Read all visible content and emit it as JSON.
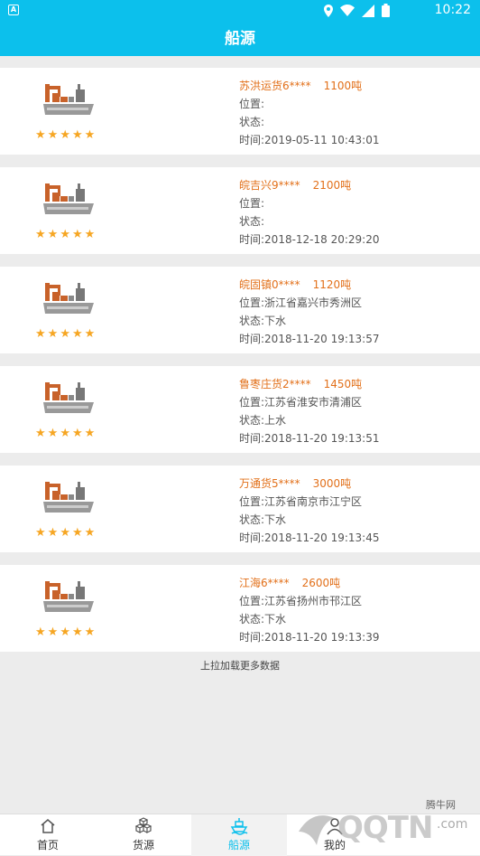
{
  "status_bar": {
    "app_icon_letter": "A",
    "time": "10:22"
  },
  "header": {
    "title": "船源"
  },
  "ships": [
    {
      "name": "苏洪运货6****",
      "tons": "1100吨",
      "location": "位置:",
      "status": "状态:",
      "time": "时间:2019-05-11 10:43:01"
    },
    {
      "name": "皖吉兴9****",
      "tons": "2100吨",
      "location": "位置:",
      "status": "状态:",
      "time": "时间:2018-12-18 20:29:20"
    },
    {
      "name": "皖固镇0****",
      "tons": "1120吨",
      "location": "位置:浙江省嘉兴市秀洲区",
      "status": "状态:下水",
      "time": "时间:2018-11-20 19:13:57"
    },
    {
      "name": "鲁枣庄货2****",
      "tons": "1450吨",
      "location": "位置:江苏省淮安市清浦区",
      "status": "状态:上水",
      "time": "时间:2018-11-20 19:13:51"
    },
    {
      "name": "万通货5****",
      "tons": "3000吨",
      "location": "位置:江苏省南京市江宁区",
      "status": "状态:下水",
      "time": "时间:2018-11-20 19:13:45"
    },
    {
      "name": "江海6****",
      "tons": "2600吨",
      "location": "位置:江苏省扬州市邗江区",
      "status": "状态:下水",
      "time": "时间:2018-11-20 19:13:39"
    }
  ],
  "rating_stars": 5,
  "load_more": "上拉加载更多数据",
  "tabs": [
    {
      "label": "首页",
      "icon": "home-icon"
    },
    {
      "label": "货源",
      "icon": "cargo-icon"
    },
    {
      "label": "船源",
      "icon": "ship-icon",
      "active": true
    },
    {
      "label": "我的",
      "icon": "user-icon"
    }
  ],
  "watermark": {
    "text": "QQTN",
    "suffix": ".com",
    "top": "腾牛网"
  },
  "colors": {
    "accent": "#0cc0ec",
    "name_orange": "#e2701a",
    "star": "#f6a623"
  }
}
